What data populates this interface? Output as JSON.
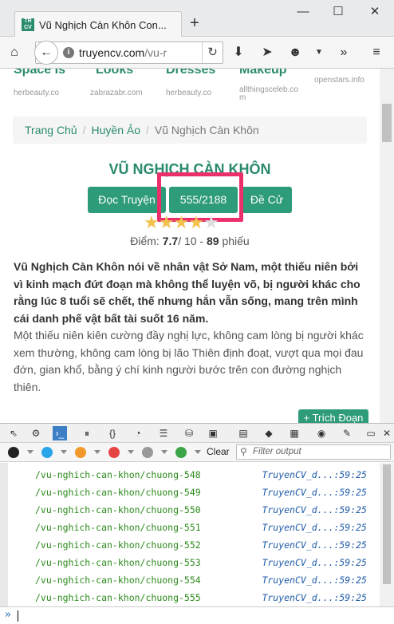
{
  "browser": {
    "tab_title": "Vũ Nghịch Càn Khôn Con...",
    "tab_favicon_text": "TR CV",
    "new_tab": "+",
    "minimize": "—",
    "maximize": "☐",
    "close": "✕",
    "url_main": "truyencv.com",
    "url_rest": "/vu-r"
  },
  "page": {
    "ads": [
      {
        "title": "Space Is",
        "source": "herbeauty.co"
      },
      {
        "title": "Looks",
        "source": "zabrazabr.com"
      },
      {
        "title": "Dresses",
        "source": "herbeauty.co"
      },
      {
        "title": "Makeup",
        "source": "allthingsceleb.co m"
      },
      {
        "title": "",
        "source": "openstars.info"
      }
    ],
    "breadcrumb": [
      "Trang Chủ",
      "Huyền Ảo",
      "Vũ Nghịch Càn Khôn"
    ],
    "title": "VŨ NGHỊCH CÀN KHÔN",
    "buttons": {
      "read": "Đọc Truyện",
      "chapters": "555/2188",
      "recommend": "Đề Cử"
    },
    "rating": {
      "stars_filled": 4,
      "stars_total": 5,
      "label": "Điểm:",
      "score": "7.7",
      "out_of": "/ 10 -",
      "votes": "89",
      "votes_label": "phiếu"
    },
    "description_bold": "Vũ Nghịch Càn Khôn nói về nhân vật Sở Nam, một thiếu niên bởi vì kinh mạch đứt đoạn mà không thể luyện võ, bị người khác cho rằng lúc 8 tuổi sẽ chết, thế nhưng hắn vẫn sống, mang trên mình cái danh phế vật bất tài suốt 16 năm.",
    "description": "Một thiếu niên kiên cường đầy nghị lực, không cam lòng bị người khác xem thường, không cam lòng bị lão Thiên định đoạt, vượt qua mọi đau đớn, gian khổ, bằng ý chí kinh người bước trên con đường nghịch thiên.",
    "excerpt_button": "Trích Đoạn",
    "excerpt_icon": "+"
  },
  "devtools": {
    "clear": "Clear",
    "filter_placeholder": "Filter output",
    "filter_colors": [
      "#222222",
      "#2aa5e8",
      "#f19a2b",
      "#e64545",
      "#999999",
      "#3aa546"
    ],
    "logs": [
      {
        "msg": "/vu-nghich-can-khon/chuong-548",
        "src": "TruyenCV_d...:59:25"
      },
      {
        "msg": "/vu-nghich-can-khon/chuong-549",
        "src": "TruyenCV_d...:59:25"
      },
      {
        "msg": "/vu-nghich-can-khon/chuong-550",
        "src": "TruyenCV_d...:59:25"
      },
      {
        "msg": "/vu-nghich-can-khon/chuong-551",
        "src": "TruyenCV_d...:59:25"
      },
      {
        "msg": "/vu-nghich-can-khon/chuong-552",
        "src": "TruyenCV_d...:59:25"
      },
      {
        "msg": "/vu-nghich-can-khon/chuong-553",
        "src": "TruyenCV_d...:59:25"
      },
      {
        "msg": "/vu-nghich-can-khon/chuong-554",
        "src": "TruyenCV_d...:59:25"
      },
      {
        "msg": "/vu-nghich-can-khon/chuong-555",
        "src": "TruyenCV_d...:59:25"
      }
    ],
    "prompt": "»"
  },
  "colors": {
    "accent": "#2e9b7a",
    "highlight": "#ea2f6b"
  }
}
